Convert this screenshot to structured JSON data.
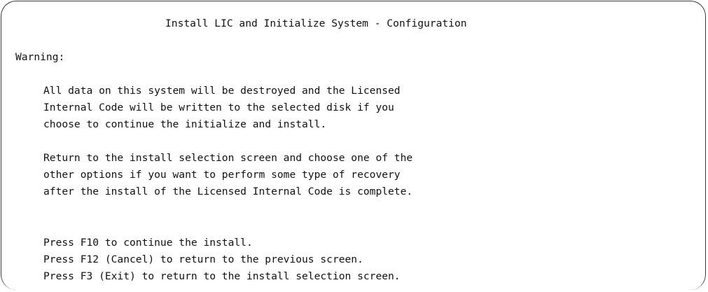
{
  "screen": {
    "title": "Install LIC and Initialize System - Configuration",
    "warning_label": "Warning:",
    "paragraphs": [
      {
        "lines": [
          "All data on this system will be destroyed and the Licensed",
          "Internal Code will be written to the selected disk if you",
          "choose to continue the initialize and install."
        ]
      },
      {
        "lines": [
          "Return to the install selection screen and choose one of the",
          "other options if you want to perform some type of recovery",
          "after the install of the Licensed Internal Code is complete."
        ]
      }
    ],
    "function_keys": [
      "Press F10 to continue the install.",
      "Press F12 (Cancel) to return to the previous screen.",
      "Press F3 (Exit) to return to the install selection screen."
    ]
  }
}
